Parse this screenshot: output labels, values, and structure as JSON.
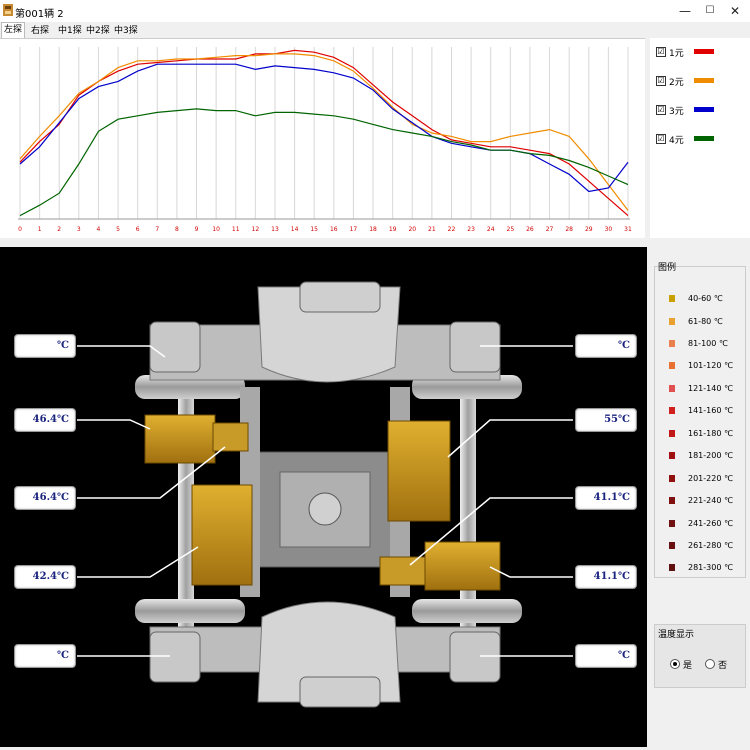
{
  "window": {
    "title": "第001辆 2",
    "minimize": "—",
    "maximize": "☐",
    "close": "✕"
  },
  "tabs": [
    "左探",
    "右探",
    "中1探",
    "中2探",
    "中3探"
  ],
  "chart_data": {
    "type": "line",
    "x": [
      0,
      1,
      2,
      3,
      4,
      5,
      6,
      7,
      8,
      9,
      10,
      11,
      12,
      13,
      14,
      15,
      16,
      17,
      18,
      19,
      20,
      21,
      22,
      23,
      24,
      25,
      26,
      27,
      28,
      29,
      30,
      31
    ],
    "xlabels": [
      "0",
      "1",
      "2",
      "3",
      "4",
      "5",
      "6",
      "7",
      "8",
      "9",
      "10",
      "11",
      "12",
      "13",
      "14",
      "15",
      "16",
      "17",
      "18",
      "19",
      "20",
      "21",
      "22",
      "23",
      "24",
      "25",
      "26",
      "27",
      "28",
      "29",
      "30",
      "31"
    ],
    "ylim": [
      0,
      100
    ],
    "grid": "vertical",
    "series": [
      {
        "name": "1元",
        "color": "#e00000",
        "values": [
          33,
          45,
          55,
          72,
          80,
          86,
          90,
          91,
          92,
          93,
          93,
          93,
          96,
          96,
          98,
          97,
          94,
          88,
          78,
          68,
          60,
          52,
          46,
          44,
          42,
          42,
          40,
          38,
          32,
          22,
          12,
          2
        ]
      },
      {
        "name": "2元",
        "color": "#f08c00",
        "values": [
          35,
          48,
          60,
          73,
          80,
          88,
          92,
          92,
          93,
          93,
          94,
          95,
          95,
          96,
          96,
          95,
          92,
          86,
          76,
          65,
          55,
          50,
          48,
          45,
          45,
          48,
          50,
          52,
          48,
          35,
          20,
          5
        ]
      },
      {
        "name": "3元",
        "color": "#0000cc",
        "values": [
          32,
          42,
          56,
          70,
          77,
          80,
          86,
          90,
          90,
          90,
          90,
          90,
          87,
          89,
          88,
          87,
          85,
          82,
          75,
          64,
          56,
          48,
          44,
          42,
          40,
          40,
          38,
          32,
          26,
          16,
          18,
          33
        ]
      },
      {
        "name": "4元",
        "color": "#006400",
        "values": [
          2,
          8,
          15,
          32,
          51,
          58,
          60,
          62,
          63,
          64,
          63,
          63,
          60,
          62,
          62,
          61,
          60,
          58,
          55,
          52,
          50,
          48,
          45,
          43,
          40,
          40,
          38,
          37,
          34,
          30,
          25,
          20
        ]
      }
    ]
  },
  "series_legend": [
    {
      "label": "1元",
      "color": "#e00000",
      "checked": "☑"
    },
    {
      "label": "2元",
      "color": "#f08c00",
      "checked": "☑"
    },
    {
      "label": "3元",
      "color": "#0000cc",
      "checked": "☑"
    },
    {
      "label": "4元",
      "color": "#006400",
      "checked": "☑"
    }
  ],
  "temps": [
    "℃",
    "46.4℃",
    "46.4℃",
    "42.4℃",
    "℃",
    "℃",
    "55℃",
    "41.1℃",
    "41.1℃",
    "℃"
  ],
  "legend": {
    "title": "图例",
    "ranges": [
      {
        "label": "40-60 ℃",
        "color": "#c8a000"
      },
      {
        "label": "61-80 ℃",
        "color": "#e8a030"
      },
      {
        "label": "81-100 ℃",
        "color": "#e88050"
      },
      {
        "label": "101-120 ℃",
        "color": "#e87030"
      },
      {
        "label": "121-140 ℃",
        "color": "#e05050"
      },
      {
        "label": "141-160 ℃",
        "color": "#d02020"
      },
      {
        "label": "161-180 ℃",
        "color": "#c01818"
      },
      {
        "label": "181-200 ℃",
        "color": "#a01010"
      },
      {
        "label": "201-220 ℃",
        "color": "#901010"
      },
      {
        "label": "221-240 ℃",
        "color": "#801010"
      },
      {
        "label": "241-260 ℃",
        "color": "#701010"
      },
      {
        "label": "261-280 ℃",
        "color": "#681010"
      },
      {
        "label": "281-300 ℃",
        "color": "#601010"
      }
    ]
  },
  "temp_display": {
    "title": "温度显示",
    "yes": "是",
    "no": "否"
  }
}
